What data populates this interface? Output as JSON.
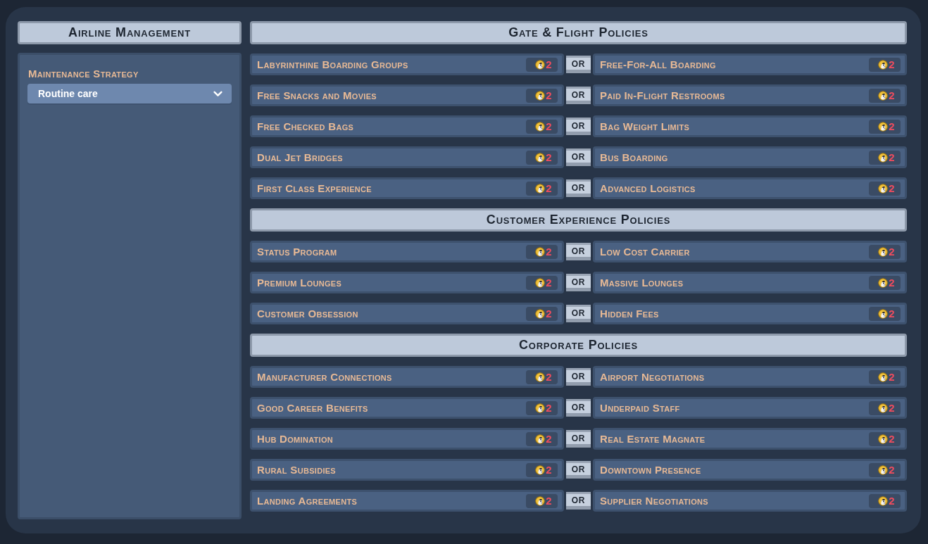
{
  "sidebar": {
    "title": "Airline Management",
    "settings": [
      {
        "label": "Maintenance Strategy",
        "value": "Routine care"
      }
    ]
  },
  "sections": [
    {
      "title": "Gate & Flight Policies",
      "pairs": [
        {
          "left": {
            "name": "Labyrinthine Boarding Groups",
            "cost": "2"
          },
          "separator": "OR",
          "right": {
            "name": "Free-For-All Boarding",
            "cost": "2"
          }
        },
        {
          "left": {
            "name": "Free Snacks and Movies",
            "cost": "2"
          },
          "separator": "OR",
          "right": {
            "name": "Paid In-Flight Restrooms",
            "cost": "2"
          }
        },
        {
          "left": {
            "name": "Free Checked Bags",
            "cost": "2"
          },
          "separator": "OR",
          "right": {
            "name": "Bag Weight Limits",
            "cost": "2"
          }
        },
        {
          "left": {
            "name": "Dual Jet Bridges",
            "cost": "2"
          },
          "separator": "OR",
          "right": {
            "name": "Bus Boarding",
            "cost": "2"
          }
        },
        {
          "left": {
            "name": "First Class Experience",
            "cost": "2"
          },
          "separator": "OR",
          "right": {
            "name": "Advanced Logistics",
            "cost": "2"
          }
        }
      ]
    },
    {
      "title": "Customer Experience Policies",
      "pairs": [
        {
          "left": {
            "name": "Status Program",
            "cost": "2"
          },
          "separator": "OR",
          "right": {
            "name": "Low Cost Carrier",
            "cost": "2"
          }
        },
        {
          "left": {
            "name": "Premium Lounges",
            "cost": "2"
          },
          "separator": "OR",
          "right": {
            "name": "Massive Lounges",
            "cost": "2"
          }
        },
        {
          "left": {
            "name": "Customer Obsession",
            "cost": "2"
          },
          "separator": "OR",
          "right": {
            "name": "Hidden Fees",
            "cost": "2"
          }
        }
      ]
    },
    {
      "title": "Corporate Policies",
      "pairs": [
        {
          "left": {
            "name": "Manufacturer Connections",
            "cost": "2"
          },
          "separator": "OR",
          "right": {
            "name": "Airport Negotiations",
            "cost": "2"
          }
        },
        {
          "left": {
            "name": "Good Career Benefits",
            "cost": "2"
          },
          "separator": "OR",
          "right": {
            "name": "Underpaid Staff",
            "cost": "2"
          }
        },
        {
          "left": {
            "name": "Hub Domination",
            "cost": "2"
          },
          "separator": "OR",
          "right": {
            "name": "Real Estate Magnate",
            "cost": "2"
          }
        },
        {
          "left": {
            "name": "Rural Subsidies",
            "cost": "2"
          },
          "separator": "OR",
          "right": {
            "name": "Downtown Presence",
            "cost": "2"
          }
        },
        {
          "left": {
            "name": "Landing Agreements",
            "cost": "2"
          },
          "separator": "OR",
          "right": {
            "name": "Supplier Negotiations",
            "cost": "2"
          }
        }
      ]
    }
  ]
}
